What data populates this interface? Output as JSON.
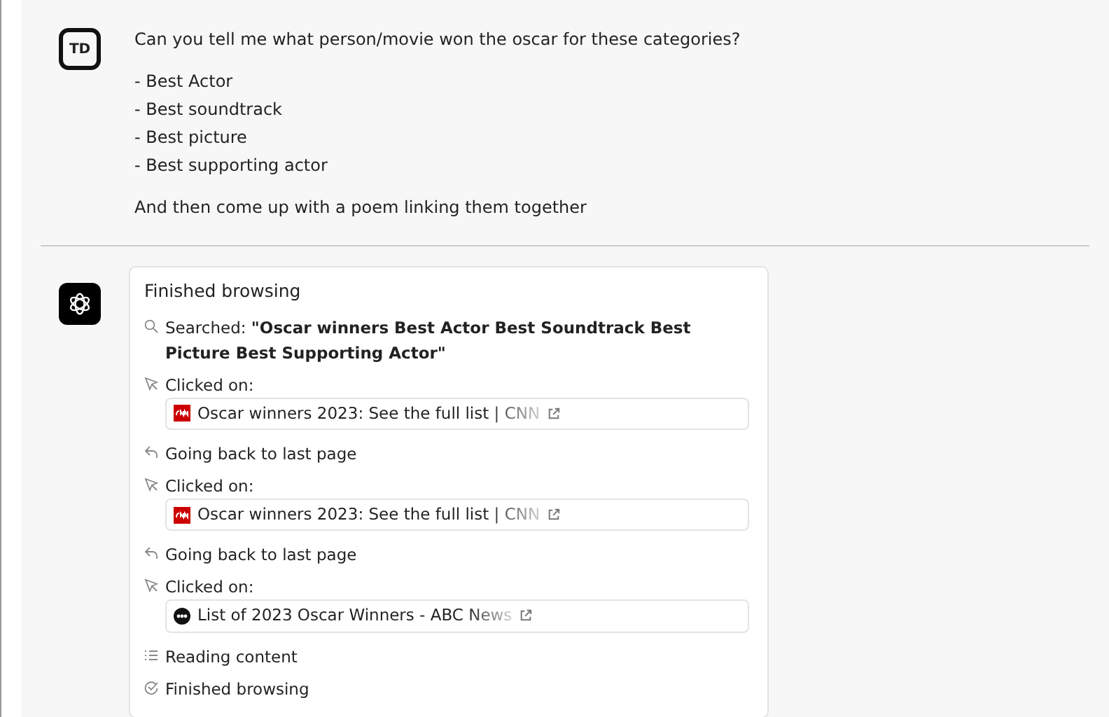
{
  "user_message": {
    "avatar": "TD",
    "question": "Can you tell me what person/movie won the oscar for these categories?",
    "list": [
      "- Best Actor",
      "- Best soundtrack",
      "- Best picture",
      "- Best supporting actor"
    ],
    "closing": "And then come up with a poem linking them together"
  },
  "browsing": {
    "title": "Finished browsing",
    "steps": [
      {
        "kind": "search",
        "text": "Searched: **\"Oscar winners Best Actor Best Soundtrack Best Picture Best Supporting Actor\"**"
      },
      {
        "kind": "click",
        "text": "Clicked on:",
        "link": {
          "kind": "cnn",
          "title": "Oscar winners 2023: See the full list | CNN"
        }
      },
      {
        "kind": "back",
        "text": "Going back to last page"
      },
      {
        "kind": "click",
        "text": "Clicked on:",
        "link": {
          "kind": "cnn",
          "title": "Oscar winners 2023: See the full list | CNN"
        }
      },
      {
        "kind": "back",
        "text": "Going back to last page"
      },
      {
        "kind": "click",
        "text": "Clicked on:",
        "link": {
          "kind": "abc",
          "title": "List of 2023 Oscar Winners - ABC News"
        }
      },
      {
        "kind": "reading",
        "text": "Reading content"
      },
      {
        "kind": "done",
        "text": "Finished browsing"
      }
    ]
  }
}
